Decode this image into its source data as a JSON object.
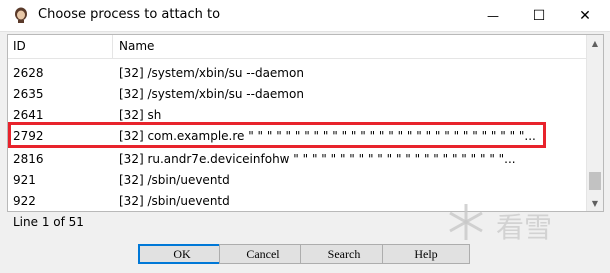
{
  "window": {
    "title": "Choose process to attach to",
    "minimize_glyph": "—",
    "maximize_glyph": "☐",
    "close_glyph": "✕"
  },
  "table": {
    "columns": [
      "ID",
      "Name"
    ],
    "rows": [
      {
        "id": "2628",
        "name": "[32] /system/xbin/su --daemon"
      },
      {
        "id": "2635",
        "name": "[32] /system/xbin/su --daemon"
      },
      {
        "id": "2641",
        "name": "[32] sh"
      },
      {
        "id": "2792",
        "name": "[32] com.example.re \" \" \" \" \" \" \" \" \" \" \" \" \" \" \" \" \" \" \" \" \" \" \" \" \" \" \" \" \" \"..."
      },
      {
        "id": "2816",
        "name": "[32] ru.andr7e.deviceinfohw \" \" \" \" \" \" \" \" \" \" \" \" \" \" \" \" \" \" \" \" \" \" \"..."
      },
      {
        "id": "921",
        "name": "[32] /sbin/ueventd"
      },
      {
        "id": "922",
        "name": "[32] /sbin/ueventd"
      }
    ],
    "selected_index": 3
  },
  "status": {
    "line_text": "Line 1 of 51"
  },
  "buttons": {
    "ok": "OK",
    "cancel": "Cancel",
    "search": "Search",
    "help": "Help"
  },
  "watermark": {
    "text": "看雪"
  },
  "colors": {
    "highlight": "#e8232c"
  }
}
